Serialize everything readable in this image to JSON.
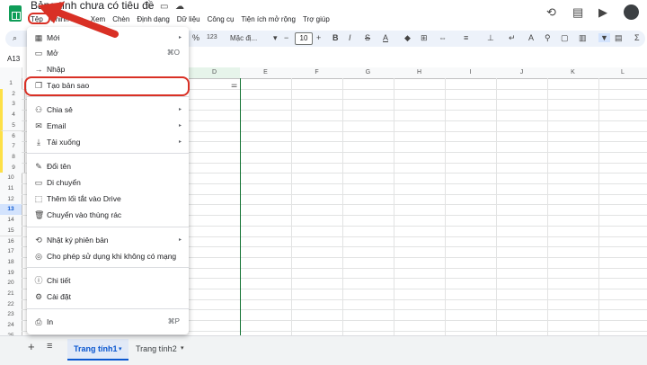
{
  "doc": {
    "title": "Bảng tính chưa có tiêu đề",
    "menu": [
      "Tệp",
      "Chỉnh sửa",
      "Xem",
      "Chèn",
      "Định dạng",
      "Dữ liệu",
      "Công cụ",
      "Tiện ích mở rộng",
      "Trợ giúp"
    ]
  },
  "toolbar": {
    "zoom": "123",
    "font": "Mặc đị...",
    "font_size": "10"
  },
  "namebox": "A13",
  "columns": [
    "D",
    "E",
    "F",
    "G",
    "H",
    "I",
    "J",
    "K",
    "L"
  ],
  "rows": [
    "1",
    "2",
    "3",
    "4",
    "5",
    "6",
    "7",
    "8",
    "9",
    "10",
    "11",
    "12",
    "13",
    "14",
    "15",
    "16",
    "17",
    "18",
    "19",
    "20",
    "21",
    "22",
    "23",
    "24",
    "25"
  ],
  "file_menu": {
    "items": [
      {
        "label": "Mới",
        "icon": "new-sheet-icon",
        "submenu": true
      },
      {
        "label": "Mở",
        "icon": "folder-open-icon",
        "shortcut": "⌘O"
      },
      {
        "label": "Nhập",
        "icon": "import-icon"
      },
      {
        "label": "Tạo bản sao",
        "icon": "copy-icon"
      },
      {
        "label": "Chia sẻ",
        "icon": "share-person-icon",
        "submenu": true
      },
      {
        "label": "Email",
        "icon": "email-icon",
        "submenu": true
      },
      {
        "label": "Tải xuống",
        "icon": "download-icon",
        "submenu": true
      },
      {
        "label": "Đổi tên",
        "icon": "rename-icon"
      },
      {
        "label": "Di chuyển",
        "icon": "move-folder-icon"
      },
      {
        "label": "Thêm lối tắt vào Drive",
        "icon": "drive-shortcut-icon"
      },
      {
        "label": "Chuyển vào thùng rác",
        "icon": "trash-icon"
      },
      {
        "label": "Nhật ký phiên bản",
        "icon": "history-icon",
        "submenu": true
      },
      {
        "label": "Cho phép sử dụng khi không có mạng",
        "icon": "offline-icon"
      },
      {
        "label": "Chi tiết",
        "icon": "info-icon"
      },
      {
        "label": "Cài đặt",
        "icon": "settings-icon"
      },
      {
        "label": "In",
        "icon": "print-icon",
        "shortcut": "⌘P"
      }
    ]
  },
  "sheets": [
    "Trang tính1",
    "Trang tính2"
  ],
  "colors": {
    "accent": "#d93025",
    "sheets_green": "#0f9d58",
    "active_tab": "#0b57d0"
  }
}
